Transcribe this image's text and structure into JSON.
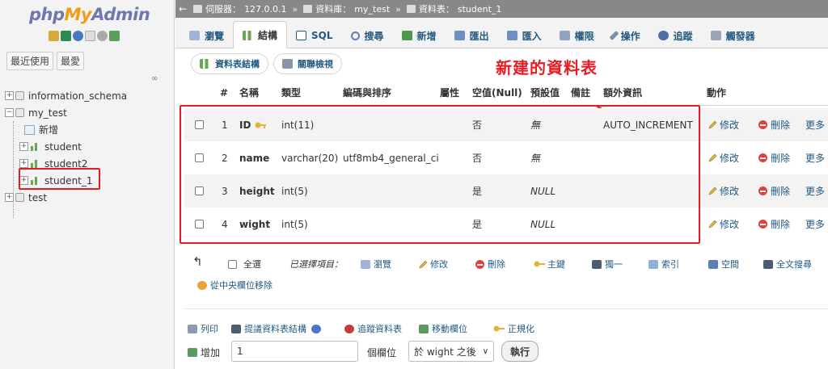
{
  "nav": {
    "logo": {
      "php": "php",
      "my": "My",
      "admin": "Admin"
    },
    "recent_label": "最近使用",
    "favorites_label": "最愛",
    "tree": [
      {
        "label": "information_schema"
      },
      {
        "label": "my_test"
      },
      {
        "label": "新增"
      },
      {
        "label": "student"
      },
      {
        "label": "student2"
      },
      {
        "label": "student_1"
      },
      {
        "label": "test"
      }
    ]
  },
  "breadcrumb": {
    "server_label": "伺服器：",
    "server": "127.0.0.1",
    "db_label": "資料庫：",
    "db": "my_test",
    "table_label": "資料表：",
    "table": "student_1"
  },
  "tabs": [
    {
      "label": "瀏覽",
      "icon": "browse-icon"
    },
    {
      "label": "結構",
      "icon": "structure-icon"
    },
    {
      "label": "SQL",
      "icon": "sql-icon"
    },
    {
      "label": "搜尋",
      "icon": "search-icon"
    },
    {
      "label": "新增",
      "icon": "insert-icon"
    },
    {
      "label": "匯出",
      "icon": "export-icon"
    },
    {
      "label": "匯入",
      "icon": "import-icon"
    },
    {
      "label": "權限",
      "icon": "privileges-icon"
    },
    {
      "label": "操作",
      "icon": "wrench-icon"
    },
    {
      "label": "追蹤",
      "icon": "eye-icon"
    },
    {
      "label": "觸發器",
      "icon": "triggers-icon"
    }
  ],
  "subtabs": [
    {
      "label": "資料表結構"
    },
    {
      "label": "關聯檢視"
    }
  ],
  "annotation": "新建的資料表",
  "columns": {
    "num": "#",
    "name": "名稱",
    "type": "類型",
    "collation": "編碼與排序",
    "attributes": "屬性",
    "null": "空值(Null)",
    "default": "預設值",
    "comments": "備註",
    "extra": "額外資訊",
    "action": "動作"
  },
  "fields": [
    {
      "num": "1",
      "name": "ID",
      "type": "int(11)",
      "collation": "",
      "null": "否",
      "default": "無",
      "extra": "AUTO_INCREMENT",
      "primary_key": true
    },
    {
      "num": "2",
      "name": "name",
      "type": "varchar(20)",
      "collation": "utf8mb4_general_ci",
      "null": "否",
      "default": "無",
      "extra": ""
    },
    {
      "num": "3",
      "name": "height",
      "type": "int(5)",
      "collation": "",
      "null": "是",
      "default": "NULL",
      "extra": ""
    },
    {
      "num": "4",
      "name": "wight",
      "type": "int(5)",
      "collation": "",
      "null": "是",
      "default": "NULL",
      "extra": ""
    }
  ],
  "row_actions": {
    "edit": "修改",
    "delete": "刪除",
    "more": "更多"
  },
  "bulk": {
    "select_all": "全選",
    "with_selected": "已選擇項目：",
    "browse": "瀏覽",
    "change": "修改",
    "drop": "刪除",
    "primary": "主鍵",
    "unique": "獨一",
    "index": "索引",
    "spatial": "空間",
    "fulltext": "全文搜尋",
    "move_central": "從中央欄位移除"
  },
  "footer": {
    "print": "列印",
    "propose": "提議資料表結構",
    "track": "追蹤資料表",
    "move_columns": "移動欄位",
    "normalize": "正規化",
    "add_label": "增加",
    "add_count": "1",
    "columns_label": "個欄位",
    "position_option": "於 wight 之後",
    "go": "執行"
  },
  "colors": {
    "accent": "#e81c24",
    "link": "#235a81"
  }
}
